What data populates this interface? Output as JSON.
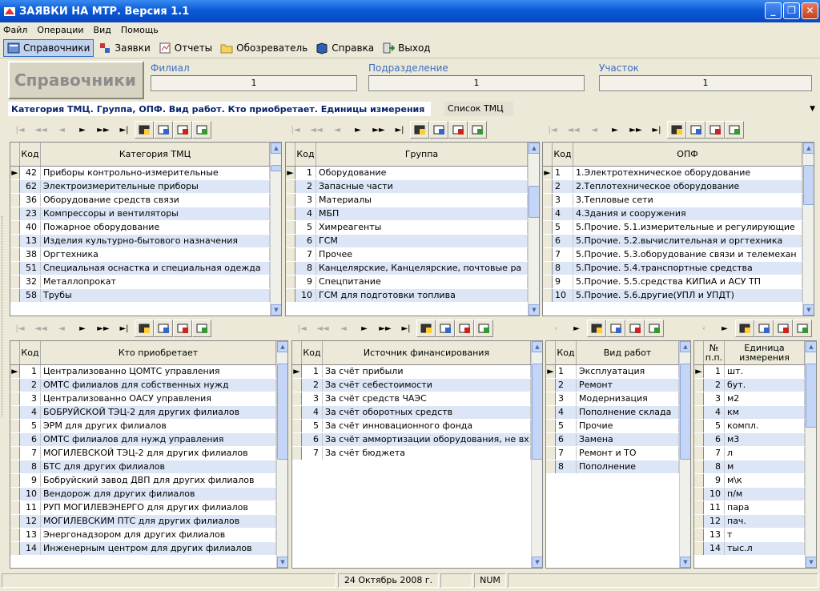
{
  "window": {
    "title": "ЗАЯВКИ НА МТР. Версия 1.1"
  },
  "menu": [
    "Файл",
    "Операции",
    "Вид",
    "Помощь"
  ],
  "toolbar": {
    "items": [
      "Справочники",
      "Заявки",
      "Отчеты",
      "Обозреватель",
      "Справка",
      "Выход"
    ]
  },
  "header": {
    "title": "Справочники",
    "filial_label": "Филиал",
    "filial_value": "1",
    "podrazd_label": "Подразделение",
    "podrazd_value": "1",
    "uchastok_label": "Участок",
    "uchastok_value": "1"
  },
  "tabs": {
    "active": "Категория ТМЦ. Группа, ОПФ. Вид работ. Кто приобретает. Единицы измерения",
    "other": "Список ТМЦ"
  },
  "grids": {
    "kategoria": {
      "h1": "Код",
      "h2": "Категория ТМЦ",
      "rows": [
        [
          "42",
          "Приборы контрольно-измерительные"
        ],
        [
          "62",
          "Электроизмерительные приборы"
        ],
        [
          "36",
          "Оборудование средств связи"
        ],
        [
          "23",
          "Компрессоры и вентиляторы"
        ],
        [
          "40",
          "Пожарное оборудование"
        ],
        [
          "13",
          "Изделия культурно-бытового назначения"
        ],
        [
          "38",
          "Оргтехника"
        ],
        [
          "51",
          "Специальная оснастка и специальная одежда"
        ],
        [
          "32",
          "Металлопрокат"
        ],
        [
          "58",
          "Трубы"
        ]
      ]
    },
    "gruppa": {
      "h1": "Код",
      "h2": "Группа",
      "rows": [
        [
          "1",
          "Оборудование"
        ],
        [
          "2",
          "Запасные части"
        ],
        [
          "3",
          "Материалы"
        ],
        [
          "4",
          "МБП"
        ],
        [
          "5",
          "Химреагенты"
        ],
        [
          "6",
          "ГСМ"
        ],
        [
          "7",
          "Прочее"
        ],
        [
          "8",
          "Канцелярские, Канцелярские, почтовые ра"
        ],
        [
          "9",
          "Спецпитание"
        ],
        [
          "10",
          "ГСМ для подготовки топлива"
        ]
      ]
    },
    "opf": {
      "h1": "Код",
      "h2": "ОПФ",
      "rows": [
        [
          "1",
          "1.Электротехническое оборудование"
        ],
        [
          "2",
          "2.Теплотехническое оборудование"
        ],
        [
          "3",
          "3.Тепловые сети"
        ],
        [
          "4",
          "4.Здания и сооружения"
        ],
        [
          "5",
          "5.Прочие. 5.1.измерительные и регулирующие"
        ],
        [
          "6",
          "5.Прочие. 5.2.вычислительная и оргтехника"
        ],
        [
          "7",
          "5.Прочие. 5.3.оборудование связи и телемехан"
        ],
        [
          "8",
          "5.Прочие. 5.4.транспортные средства"
        ],
        [
          "9",
          "5.Прочие. 5.5.средства КИПиА и АСУ ТП"
        ],
        [
          "10",
          "5.Прочие. 5.6.другие(УПЛ и УПДТ)"
        ]
      ]
    },
    "kto": {
      "h1": "Код",
      "h2": "Кто приобретает",
      "rows": [
        [
          "1",
          "Централизованно ЦОМТС управления"
        ],
        [
          "2",
          "ОМТС филиалов для собственных нужд"
        ],
        [
          "3",
          "Централизованно ОАСУ управления"
        ],
        [
          "4",
          "БОБРУЙСКОЙ ТЭЦ-2 для других филиалов"
        ],
        [
          "5",
          "ЭРМ для других филиалов"
        ],
        [
          "6",
          "ОМТС филиалов для нужд управления"
        ],
        [
          "7",
          "МОГИЛЕВСКОЙ ТЭЦ-2  для других филиалов"
        ],
        [
          "8",
          "БТС для других филиалов"
        ],
        [
          "9",
          "Бобруйский завод ДВП для других филиалов"
        ],
        [
          "10",
          "Вендорож для других филиалов"
        ],
        [
          "11",
          "РУП МОГИЛЕВЭНЕРГО для других филиалов"
        ],
        [
          "12",
          "МОГИЛЕВСКИМ ПТС для других филиалов"
        ],
        [
          "13",
          "Энергонадзором для других филиалов"
        ],
        [
          "14",
          "Инженерным центром для других филиалов"
        ]
      ]
    },
    "istochnik": {
      "h1": "Код",
      "h2": "Источник финансирования",
      "rows": [
        [
          "1",
          "За счёт прибыли"
        ],
        [
          "2",
          "За счёт себестоимости"
        ],
        [
          "3",
          "За счёт средств ЧАЭС"
        ],
        [
          "4",
          "За счёт оборотных средств"
        ],
        [
          "5",
          "За счёт инновационного фонда"
        ],
        [
          "6",
          "За счёт аммортизации оборудования, не вх"
        ],
        [
          "7",
          "За счёт бюджета"
        ]
      ]
    },
    "vid": {
      "h1": "Код",
      "h2": "Вид работ",
      "rows": [
        [
          "1",
          "Эксплуатация"
        ],
        [
          "2",
          "Ремонт"
        ],
        [
          "3",
          "Модернизация"
        ],
        [
          "4",
          "Пополнение склада"
        ],
        [
          "5",
          "Прочие"
        ],
        [
          "6",
          "Замена"
        ],
        [
          "7",
          "Ремонт и ТО"
        ],
        [
          "8",
          "Пополнение"
        ]
      ]
    },
    "edinica": {
      "h1": "№ п.п.",
      "h2": "Единица измерения",
      "rows": [
        [
          "1",
          "шт."
        ],
        [
          "2",
          "бут."
        ],
        [
          "3",
          "м2"
        ],
        [
          "4",
          "км"
        ],
        [
          "5",
          "компл."
        ],
        [
          "6",
          "м3"
        ],
        [
          "7",
          "л"
        ],
        [
          "8",
          "м"
        ],
        [
          "9",
          "м\\к"
        ],
        [
          "10",
          "п/м"
        ],
        [
          "11",
          "пара"
        ],
        [
          "12",
          "пач."
        ],
        [
          "13",
          "т"
        ],
        [
          "14",
          "тыс.л"
        ]
      ]
    }
  },
  "status": {
    "date": "24 Октябрь 2008 г.",
    "num": "NUM"
  }
}
